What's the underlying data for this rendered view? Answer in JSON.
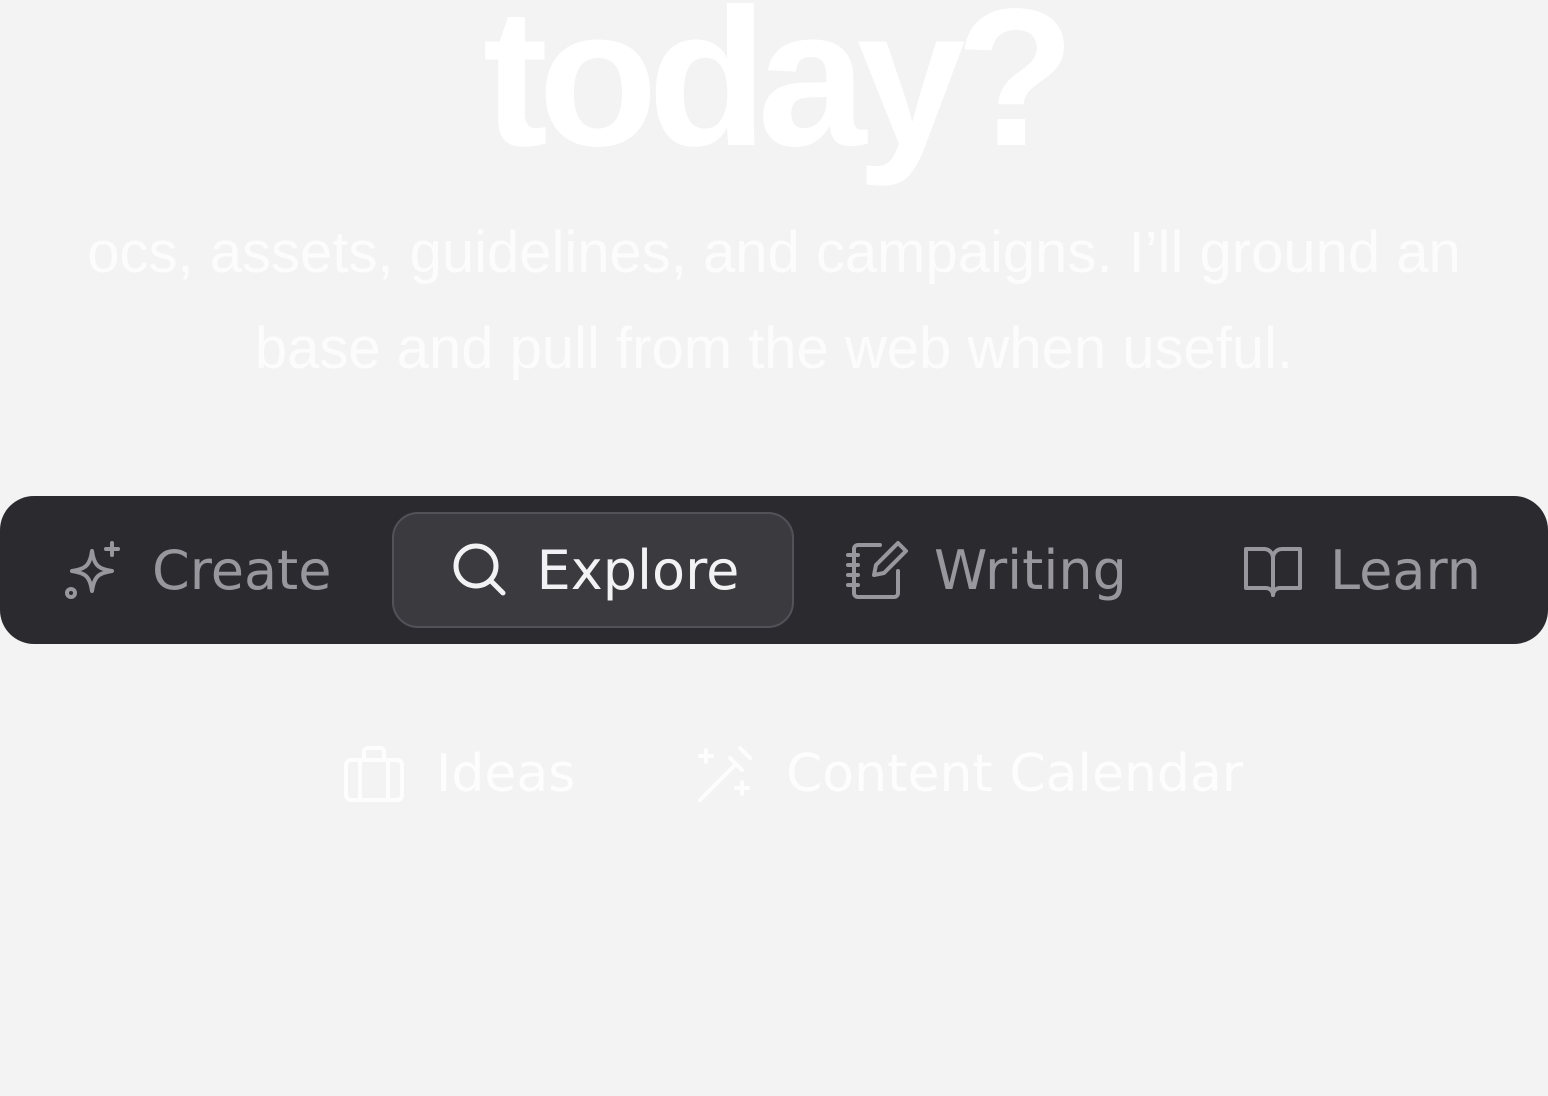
{
  "hero": {
    "title": "today?",
    "subtitle_line1": "ocs, assets, guidelines, and campaigns. I’ll ground an",
    "subtitle_line2": "base and pull from the web when useful."
  },
  "tabs": [
    {
      "label": "Create",
      "icon": "sparkles-icon",
      "active": false
    },
    {
      "label": "Explore",
      "icon": "search-icon",
      "active": true
    },
    {
      "label": "Writing",
      "icon": "notebook-pen-icon",
      "active": false
    },
    {
      "label": "Learn",
      "icon": "open-book-icon",
      "active": false
    }
  ],
  "quick_actions": [
    {
      "label": "Ideas",
      "icon": "briefcase-icon"
    },
    {
      "label": "Content Calendar",
      "icon": "magic-wand-icon"
    }
  ],
  "colors": {
    "background": "#f3f3f3",
    "tabbar": "#2b2b2f",
    "active_tab": "#3a3a3f",
    "inactive_text": "#97979d",
    "active_text": "#f2f2f4"
  }
}
